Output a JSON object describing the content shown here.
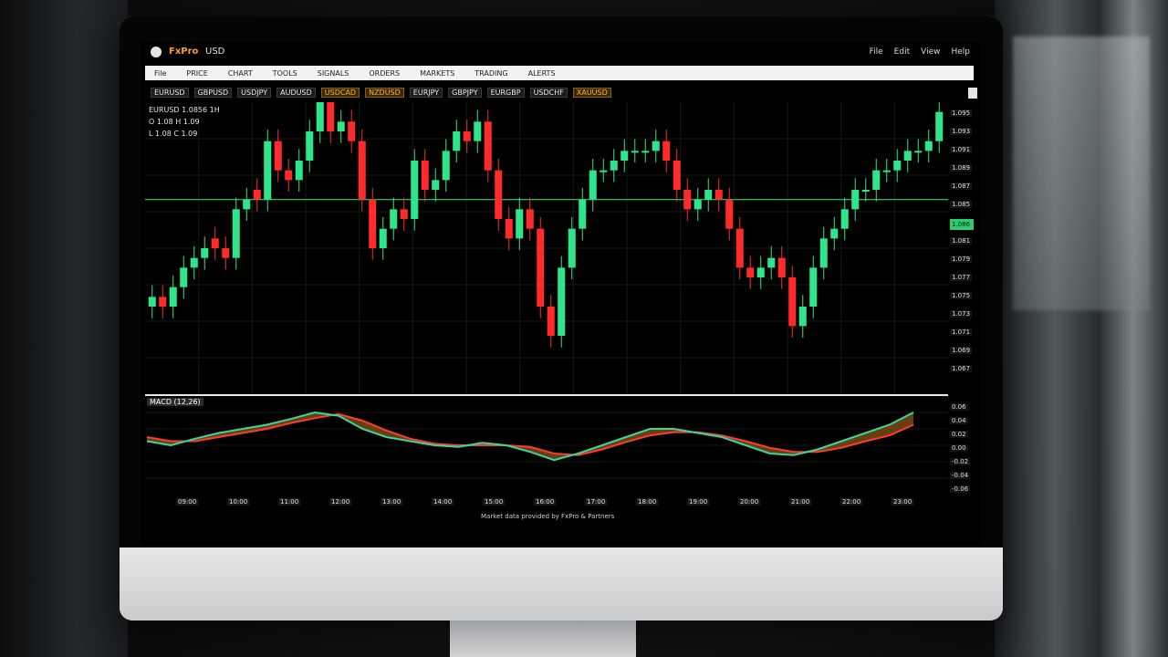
{
  "app": {
    "name": "FxPro",
    "subtitle": "USD"
  },
  "window_controls": [
    "File",
    "Edit",
    "View",
    "Help"
  ],
  "menu": [
    "File",
    "PRICE",
    "CHART",
    "TOOLS",
    "SIGNALS",
    "ORDERS",
    "MARKETS",
    "TRADING",
    "ALERTS"
  ],
  "tickers": [
    {
      "label": "EURUSD",
      "highlight": false
    },
    {
      "label": "GBPUSD",
      "highlight": false
    },
    {
      "label": "USDJPY",
      "highlight": false
    },
    {
      "label": "AUDUSD",
      "highlight": false
    },
    {
      "label": "USDCAD",
      "highlight": true
    },
    {
      "label": "NZDUSD",
      "highlight": true
    },
    {
      "label": "EURJPY",
      "highlight": false
    },
    {
      "label": "GBPJPY",
      "highlight": false
    },
    {
      "label": "EURGBP",
      "highlight": false
    },
    {
      "label": "USDCHF",
      "highlight": false
    },
    {
      "label": "XAUUSD",
      "highlight": true
    }
  ],
  "legend": {
    "symbol": "EURUSD 1.0856 1H",
    "line2": "O 1.08 H 1.09",
    "line3": "L 1.08 C 1.09"
  },
  "oscillator": {
    "title": "MACD (12,26)"
  },
  "price_axis": [
    "1.095",
    "1.093",
    "1.091",
    "1.089",
    "1.087",
    "1.085",
    "1.083",
    "1.081",
    "1.079",
    "1.077",
    "1.075",
    "1.073",
    "1.071",
    "1.069",
    "1.067"
  ],
  "current_price": "1.086",
  "osc_axis": [
    "0.06",
    "0.04",
    "0.02",
    "0.00",
    "-0.02",
    "-0.04",
    "-0.06"
  ],
  "time_axis": [
    "09:00",
    "10:00",
    "11:00",
    "12:00",
    "13:00",
    "14:00",
    "15:00",
    "16:00",
    "17:00",
    "18:00",
    "19:00",
    "20:00",
    "21:00",
    "22:00",
    "23:00"
  ],
  "footer": "Market data provided by FxPro & Partners",
  "colors": {
    "bull": "#2ee58b",
    "bear": "#ff2a2a",
    "level_line": "#3ad15a",
    "osc_fast": "#35d9a0",
    "osc_slow": "#ff3b30",
    "osc_fill": "#7a4a14"
  },
  "chart_data": [
    {
      "type": "candlestick",
      "title": "",
      "ylim": [
        1.066,
        1.096
      ],
      "level_line": 1.086,
      "grid": true,
      "close_series": [
        1.076,
        1.075,
        1.077,
        1.079,
        1.08,
        1.081,
        1.081,
        1.08,
        1.085,
        1.086,
        1.086,
        1.092,
        1.089,
        1.088,
        1.09,
        1.093,
        1.096,
        1.093,
        1.094,
        1.092,
        1.086,
        1.081,
        1.083,
        1.085,
        1.084,
        1.09,
        1.087,
        1.088,
        1.091,
        1.093,
        1.092,
        1.094,
        1.089,
        1.084,
        1.082,
        1.085,
        1.083,
        1.075,
        1.072,
        1.079,
        1.083,
        1.086,
        1.089,
        1.089,
        1.09,
        1.091,
        1.091,
        1.091,
        1.092,
        1.09,
        1.087,
        1.085,
        1.086,
        1.087,
        1.086,
        1.083,
        1.079,
        1.078,
        1.079,
        1.08,
        1.078,
        1.073,
        1.075,
        1.079,
        1.082,
        1.083,
        1.085,
        1.087,
        1.087,
        1.089,
        1.089,
        1.09,
        1.091,
        1.091,
        1.092,
        1.095
      ],
      "open_series": [
        1.075,
        1.076,
        1.075,
        1.077,
        1.079,
        1.08,
        1.082,
        1.081,
        1.08,
        1.085,
        1.087,
        1.086,
        1.092,
        1.089,
        1.088,
        1.09,
        1.093,
        1.096,
        1.093,
        1.094,
        1.092,
        1.086,
        1.081,
        1.083,
        1.085,
        1.084,
        1.09,
        1.087,
        1.088,
        1.091,
        1.093,
        1.092,
        1.094,
        1.089,
        1.084,
        1.082,
        1.085,
        1.083,
        1.075,
        1.072,
        1.079,
        1.083,
        1.086,
        1.089,
        1.089,
        1.09,
        1.091,
        1.091,
        1.091,
        1.092,
        1.09,
        1.087,
        1.085,
        1.086,
        1.087,
        1.086,
        1.083,
        1.079,
        1.078,
        1.079,
        1.08,
        1.078,
        1.073,
        1.075,
        1.079,
        1.082,
        1.083,
        1.085,
        1.087,
        1.087,
        1.089,
        1.089,
        1.09,
        1.091,
        1.091,
        1.092
      ]
    },
    {
      "type": "line",
      "title": "",
      "ylim": [
        -0.06,
        0.06
      ],
      "series": [
        {
          "values": [
            0.005,
            0.0,
            0.008,
            0.015,
            0.02,
            0.025,
            0.032,
            0.04,
            0.036,
            0.02,
            0.01,
            0.005,
            0.0,
            -0.002,
            0.003,
            0.0,
            -0.008,
            -0.018,
            -0.01,
            0.0,
            0.01,
            0.02,
            0.02,
            0.015,
            0.01,
            0.0,
            -0.01,
            -0.012,
            -0.005,
            0.005,
            0.015,
            0.025,
            0.04
          ]
        },
        {
          "values": [
            0.01,
            0.005,
            0.005,
            0.01,
            0.015,
            0.02,
            0.027,
            0.033,
            0.038,
            0.03,
            0.018,
            0.008,
            0.002,
            0.0,
            0.0,
            0.0,
            -0.002,
            -0.01,
            -0.012,
            -0.005,
            0.004,
            0.012,
            0.016,
            0.016,
            0.012,
            0.005,
            -0.003,
            -0.008,
            -0.008,
            -0.003,
            0.005,
            0.012,
            0.025
          ]
        }
      ]
    }
  ]
}
